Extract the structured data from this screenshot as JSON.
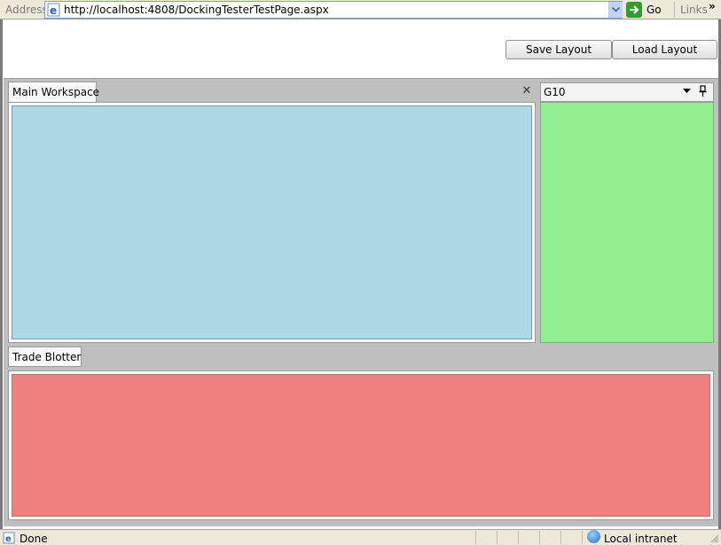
{
  "address_bar": {
    "label": "Address",
    "url": "http://localhost:4808/DockingTesterTestPage.aspx",
    "go_label": "Go",
    "links_label": "Links",
    "overflow_chevron": "»"
  },
  "toolbar": {
    "save_label": "Save Layout",
    "load_label": "Load Layout"
  },
  "workspace": {
    "tab_label": "Main Workspace",
    "close_glyph": "✕",
    "content_color": "#add8e6"
  },
  "side_panel": {
    "title": "G10",
    "content_color": "#90ee90"
  },
  "blotter": {
    "tab_label": "Trade Blotter",
    "content_color": "#f08080"
  },
  "status_bar": {
    "status_text": "Done",
    "zone_text": "Local intranet"
  },
  "icons": {
    "page": "ie-page-icon",
    "dropdown": "chevron-down-icon",
    "go": "go-arrow-icon",
    "close": "close-icon",
    "menu": "dropdown-triangle-icon",
    "pin": "pin-icon",
    "zone": "globe-icon",
    "grip": "resize-grip-icon"
  }
}
